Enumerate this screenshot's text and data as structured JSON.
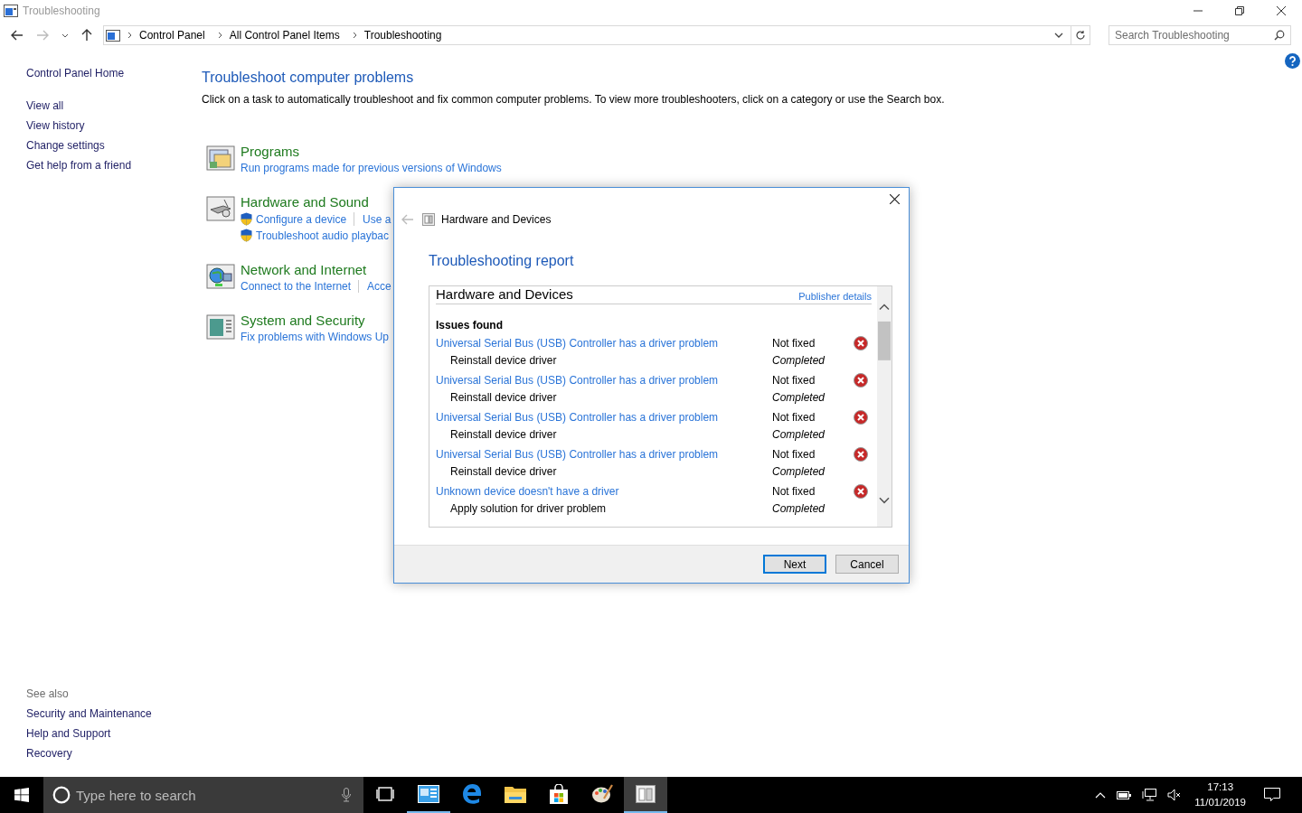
{
  "window": {
    "title": "Troubleshooting"
  },
  "address_bar": {
    "path": [
      "Control Panel",
      "All Control Panel Items",
      "Troubleshooting"
    ]
  },
  "search": {
    "placeholder": "Search Troubleshooting"
  },
  "sidebar": {
    "home": "Control Panel Home",
    "items": [
      "View all",
      "View history",
      "Change settings",
      "Get help from a friend"
    ],
    "see_also": {
      "title": "See also",
      "items": [
        "Security and Maintenance",
        "Help and Support",
        "Recovery"
      ]
    }
  },
  "main": {
    "title": "Troubleshoot computer problems",
    "description": "Click on a task to automatically troubleshoot and fix common computer problems. To view more troubleshooters, click on a category or use the Search box.",
    "categories": [
      {
        "kind": "programs",
        "title": "Programs",
        "task_rows": [
          [
            {
              "label": "Run programs made for previous versions of Windows",
              "shield": false
            }
          ]
        ]
      },
      {
        "kind": "hardware",
        "title": "Hardware and Sound",
        "task_rows": [
          [
            {
              "label": "Configure a device",
              "shield": true
            },
            {
              "label": "Use a",
              "shield": false
            }
          ],
          [
            {
              "label": "Troubleshoot audio playbac",
              "shield": true
            }
          ]
        ]
      },
      {
        "kind": "network",
        "title": "Network and Internet",
        "task_rows": [
          [
            {
              "label": "Connect to the Internet",
              "shield": false
            },
            {
              "label": "Acce",
              "shield": false
            }
          ]
        ]
      },
      {
        "kind": "system",
        "title": "System and Security",
        "task_rows": [
          [
            {
              "label": "Fix problems with Windows Up",
              "shield": false
            }
          ]
        ]
      }
    ]
  },
  "dialog": {
    "title": "Hardware and Devices",
    "heading": "Troubleshooting report",
    "report": {
      "section": "Hardware and Devices",
      "publisher_link": "Publisher details",
      "issues_title": "Issues found",
      "issues": [
        {
          "problem": "Universal Serial Bus (USB) Controller has a driver problem",
          "status": "Not fixed",
          "fixed": false,
          "action": "Reinstall device driver",
          "action_status": "Completed"
        },
        {
          "problem": "Universal Serial Bus (USB) Controller has a driver problem",
          "status": "Not fixed",
          "fixed": false,
          "action": "Reinstall device driver",
          "action_status": "Completed"
        },
        {
          "problem": "Universal Serial Bus (USB) Controller has a driver problem",
          "status": "Not fixed",
          "fixed": false,
          "action": "Reinstall device driver",
          "action_status": "Completed"
        },
        {
          "problem": "Universal Serial Bus (USB) Controller has a driver problem",
          "status": "Not fixed",
          "fixed": false,
          "action": "Reinstall device driver",
          "action_status": "Completed"
        },
        {
          "problem": "Unknown device doesn't have a driver",
          "status": "Not fixed",
          "fixed": false,
          "action": "Apply solution for driver problem",
          "action_status": "Completed"
        }
      ]
    },
    "buttons": [
      {
        "label": "Next",
        "default": true
      },
      {
        "label": "Cancel",
        "default": false
      }
    ]
  },
  "taskbar": {
    "search_placeholder": "Type here to search",
    "time": "17:13",
    "date": "11/01/2019",
    "apps": [
      {
        "kind": "control-panel",
        "running": true,
        "selected": false
      },
      {
        "kind": "edge",
        "running": false,
        "selected": false
      },
      {
        "kind": "explorer",
        "running": false,
        "selected": false
      },
      {
        "kind": "store",
        "running": false,
        "selected": false
      },
      {
        "kind": "paint",
        "running": false,
        "selected": false
      },
      {
        "kind": "troubleshooter",
        "running": true,
        "selected": true
      }
    ]
  }
}
